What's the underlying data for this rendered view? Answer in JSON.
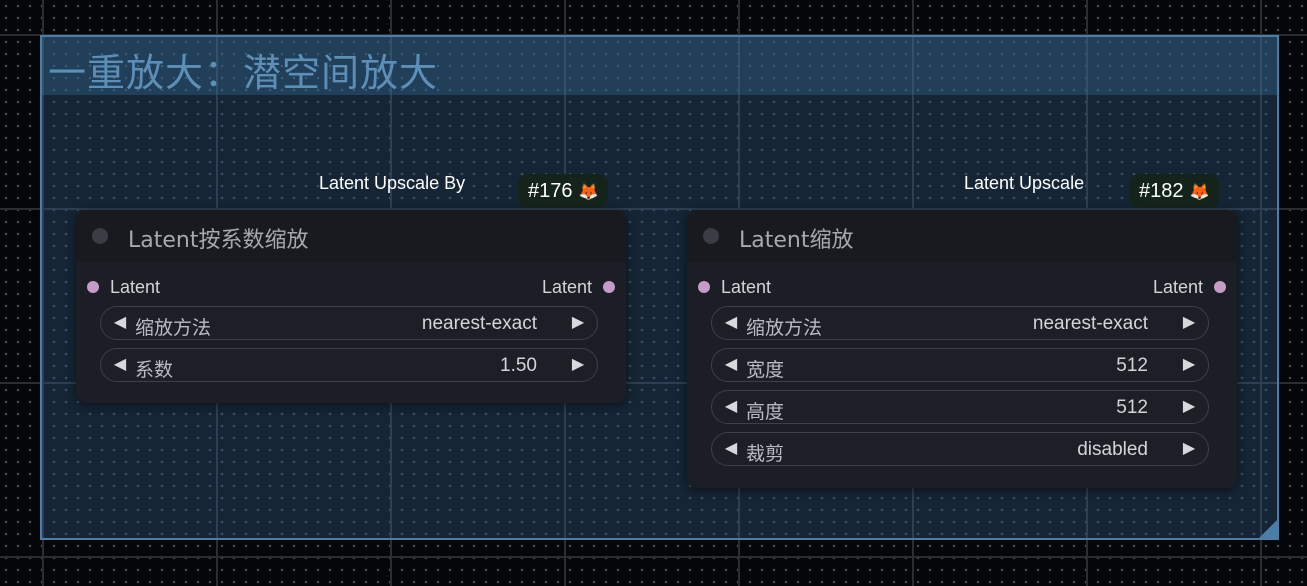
{
  "group": {
    "title": "一重放大：潜空间放大"
  },
  "nodes": [
    {
      "caption": "Latent Upscale By",
      "badge": "#176",
      "title": "Latent按系数缩放",
      "input_label": "Latent",
      "output_label": "Latent",
      "widgets": [
        {
          "name": "缩放方法",
          "value": "nearest-exact"
        },
        {
          "name": "系数",
          "value": "1.50"
        }
      ]
    },
    {
      "caption": "Latent Upscale",
      "badge": "#182",
      "title": "Latent缩放",
      "input_label": "Latent",
      "output_label": "Latent",
      "widgets": [
        {
          "name": "缩放方法",
          "value": "nearest-exact"
        },
        {
          "name": "宽度",
          "value": "512"
        },
        {
          "name": "高度",
          "value": "512"
        },
        {
          "name": "裁剪",
          "value": "disabled"
        }
      ]
    }
  ],
  "icons": {
    "badge_icon": "fox-face-icon",
    "widget_left": "triangle-left-icon",
    "widget_right": "triangle-right-icon"
  },
  "colors": {
    "canvas_bg": "#050607",
    "group_fill": "#346591",
    "group_border": "#4a7ea8",
    "node_bg": "#1b1e24",
    "slot_color": "#c79bc7",
    "badge_bg": "#15241a"
  }
}
